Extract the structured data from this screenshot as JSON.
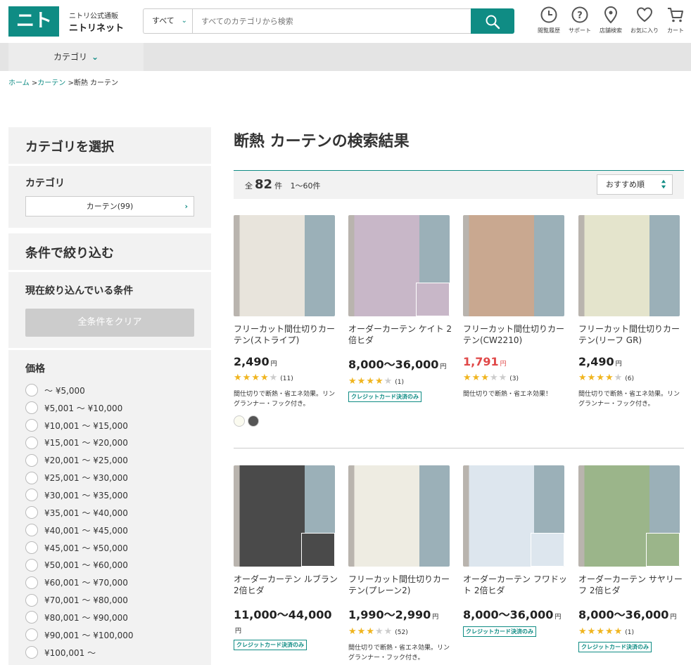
{
  "header": {
    "logo_text": "ニトリ",
    "logo_sub": "ニトリ公式通販",
    "logo_main": "ニトリネット",
    "search_category": "すべて",
    "search_placeholder": "すべてのカテゴリから検索",
    "icons": [
      {
        "label": "閲覧履歴",
        "icon": "history-icon"
      },
      {
        "label": "サポート",
        "icon": "support-icon"
      },
      {
        "label": "店舗検索",
        "icon": "store-pin-icon"
      },
      {
        "label": "お気に入り",
        "icon": "heart-icon"
      },
      {
        "label": "カート",
        "icon": "cart-icon"
      }
    ]
  },
  "category_bar": {
    "label": "カテゴリ"
  },
  "breadcrumb": {
    "home": "ホーム",
    "sep1": ">",
    "curtain": "カーテン",
    "sep2": ">",
    "current": "断熱 カーテン"
  },
  "sidebar": {
    "category_select_title": "カテゴリを選択",
    "category_label": "カテゴリ",
    "category_button": "カーテン(99)",
    "filter_title": "条件で絞り込む",
    "current_filter_label": "現在絞り込んでいる条件",
    "clear_button": "全条件をクリア",
    "price_label": "価格",
    "price_ranges": [
      "～ ¥5,000",
      "¥5,001 ～ ¥10,000",
      "¥10,001 ～ ¥15,000",
      "¥15,001 ～ ¥20,000",
      "¥20,001 ～ ¥25,000",
      "¥25,001 ～ ¥30,000",
      "¥30,001 ～ ¥35,000",
      "¥35,001 ～ ¥40,000",
      "¥40,001 ～ ¥45,000",
      "¥45,001 ～ ¥50,000",
      "¥50,001 ～ ¥60,000",
      "¥60,001 ～ ¥70,000",
      "¥70,001 ～ ¥80,000",
      "¥80,001 ～ ¥90,000",
      "¥90,001 ～ ¥100,000",
      "¥100,001 ～"
    ]
  },
  "results": {
    "title": "断熱 カーテンの検索結果",
    "total_prefix": "全",
    "total": "82",
    "total_suffix": "件",
    "range": "1～60件",
    "sort_label": "おすすめ順",
    "yen": "円",
    "credit_label": "クレジットカード決済のみ"
  },
  "products": [
    {
      "name": "フリーカット間仕切りカーテン(ストライプ)",
      "price": "2,490",
      "rating": 4,
      "reviews": "(11)",
      "desc": "間仕切りで断熱・省エネ効果。リングランナー・フック付き。",
      "credit": false,
      "red": false,
      "swatches": [
        "#fbfbf0",
        "#555555"
      ],
      "color": "#e8e4dc"
    },
    {
      "name": "オーダーカーテン ケイト 2倍ヒダ",
      "price": "8,000～36,000",
      "rating": 4,
      "reviews": "(1)",
      "desc": "",
      "credit": true,
      "red": false,
      "swatches": [],
      "color": "#c8b7c8"
    },
    {
      "name": "フリーカット間仕切りカーテン(CW2210)",
      "price": "1,791",
      "rating": 3,
      "reviews": "(3)",
      "desc": "間仕切りで断熱・省エネ効果！",
      "credit": false,
      "red": true,
      "swatches": [],
      "color": "#c9a890"
    },
    {
      "name": "フリーカット間仕切りカーテン(リーフ GR)",
      "price": "2,490",
      "rating": 4,
      "reviews": "(6)",
      "desc": "間仕切りで断熱・省エネ効果。リングランナー・フック付き。",
      "credit": false,
      "red": false,
      "swatches": [],
      "color": "#e4e4cc"
    },
    {
      "name": "オーダーカーテン ルブラン 2倍ヒダ",
      "price": "11,000～44,000",
      "rating": 0,
      "reviews": "",
      "desc": "",
      "credit": true,
      "red": false,
      "swatches": [],
      "color": "#4a4a4a"
    },
    {
      "name": "フリーカット間仕切りカーテン(プレーン2)",
      "price": "1,990～2,990",
      "rating": 3,
      "reviews": "(52)",
      "desc": "間仕切りで断熱・省エネ効果。リングランナー・フック付き。",
      "credit": false,
      "red": false,
      "swatches": [],
      "color": "#eeece2"
    },
    {
      "name": "オーダーカーテン フワドット 2倍ヒダ",
      "price": "8,000～36,000",
      "rating": 0,
      "reviews": "",
      "desc": "",
      "credit": true,
      "red": false,
      "swatches": [],
      "color": "#dde6ee"
    },
    {
      "name": "オーダーカーテン サヤリーフ 2倍ヒダ",
      "price": "8,000～36,000",
      "rating": 5,
      "reviews": "(1)",
      "desc": "",
      "credit": true,
      "red": false,
      "swatches": [],
      "color": "#9bb58a"
    }
  ]
}
